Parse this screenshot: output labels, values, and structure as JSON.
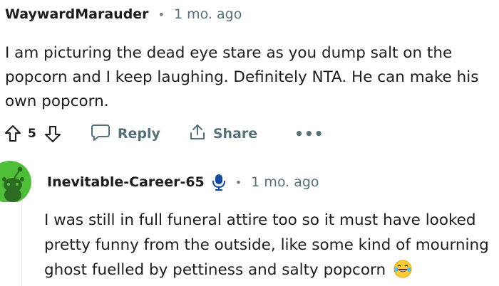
{
  "comment": {
    "username": "WaywardMarauder",
    "separator": "•",
    "timestamp": "1 mo. ago",
    "body": "I am picturing the dead eye stare as you dump salt on the popcorn and I keep laughing. Definitely NTA. He can make his own popcorn.",
    "votes": "5",
    "reply_label": "Reply",
    "share_label": "Share",
    "more_label": "•••",
    "icons": [
      "upvote-icon",
      "downvote-icon",
      "reply-bubble-icon",
      "share-icon",
      "more-icon"
    ]
  },
  "reply": {
    "username": "Inevitable-Career-65",
    "separator": "•",
    "timestamp": "1 mo. ago",
    "body": "I was still in full funeral attire too so it must have looked pretty funny from the outside, like some kind of mourning ghost fuelled by pettiness and salty popcorn",
    "icons": [
      "avatar-snoo-icon",
      "microphone-icon",
      "laughing-tears-emoji"
    ],
    "avatar_color": "#4fbf3a"
  }
}
